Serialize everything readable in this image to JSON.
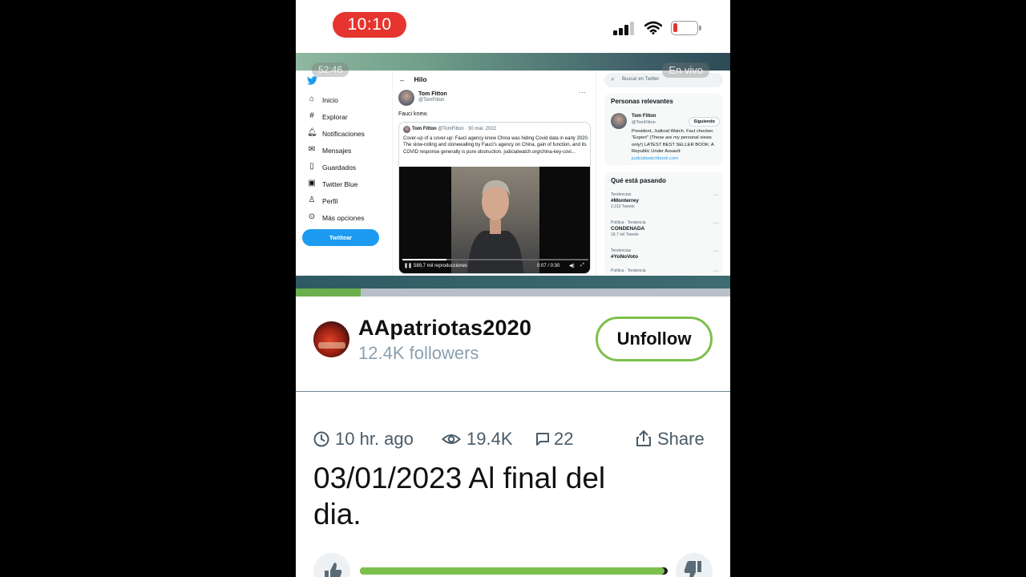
{
  "status_bar": {
    "time": "10:10",
    "battery_level": 0.18,
    "colors": {
      "time_pill": "#e5352e"
    }
  },
  "video": {
    "elapsed": "52:46",
    "live_label": "En vivo",
    "progress": 0.15,
    "embedded_tweet": {
      "nav": [
        {
          "icon": "home-icon",
          "label": "Inicio"
        },
        {
          "icon": "hashtag-icon",
          "label": "Explorar"
        },
        {
          "icon": "bell-icon",
          "label": "Notificaciones"
        },
        {
          "icon": "mail-icon",
          "label": "Mensajes"
        },
        {
          "icon": "bookmark-icon",
          "label": "Guardados"
        },
        {
          "icon": "twitter-blue-icon",
          "label": "Twitter Blue"
        },
        {
          "icon": "person-icon",
          "label": "Perfil"
        },
        {
          "icon": "more-icon",
          "label": "Más opciones"
        }
      ],
      "tweet_button": "Twittear",
      "thread_title": "Hilo",
      "author_name": "Tom Fitton",
      "author_handle": "@TomFitton",
      "tweet_text": "Fauci knew.",
      "quote": {
        "author_name": "Tom Fitton",
        "meta": "@TomFitton · 30 mar. 2022",
        "body": "Cover-up of a cover-up: Fauci agency knew China was hiding Covid data in early 2020. The slow-rolling and stonewalling by Fauci's agency on China, gain of function, and its COVID response generally is pure obstruction. judicialwatch.org/china-key-covi...",
        "views": "589,7 mil reproducciones",
        "time": "0:07 / 0:30"
      },
      "search_placeholder": "Buscar en Twitter",
      "relevant_title": "Personas relevantes",
      "relevant_person": {
        "name": "Tom Fitton",
        "handle": "@TomFitton",
        "follow_label": "Siguiendo",
        "bio": "President, Judicial Watch. Fact checker. \"Expert\" (These are my personal views only!) LATEST BEST SELLER BOOK: A Republic Under Assault: ",
        "bio_link": "judicialwatchbook.com"
      },
      "trends_title": "Qué está pasando",
      "trends": [
        {
          "category": "Tendencias",
          "name": "#Monterrey",
          "count": "2.310 Tweets"
        },
        {
          "category": "Política · Tendencia",
          "name": "CONDENADA",
          "count": "18,7 mil Tweets"
        },
        {
          "category": "Tendencias",
          "name": "#YoNoVoto",
          "count": ""
        },
        {
          "category": "Política · Tendencia",
          "name": "",
          "count": ""
        }
      ]
    }
  },
  "channel": {
    "name": "AApatriotas2020",
    "followers": "12.4K followers",
    "unfollow_label": "Unfollow",
    "accent_color": "#7cc04c"
  },
  "meta": {
    "time_ago": "10 hr. ago",
    "views": "19.4K",
    "comments": "22",
    "share_label": "Share"
  },
  "title": "03/01/2023 Al final del dia.",
  "rating": {
    "like_ratio": 0.99
  }
}
